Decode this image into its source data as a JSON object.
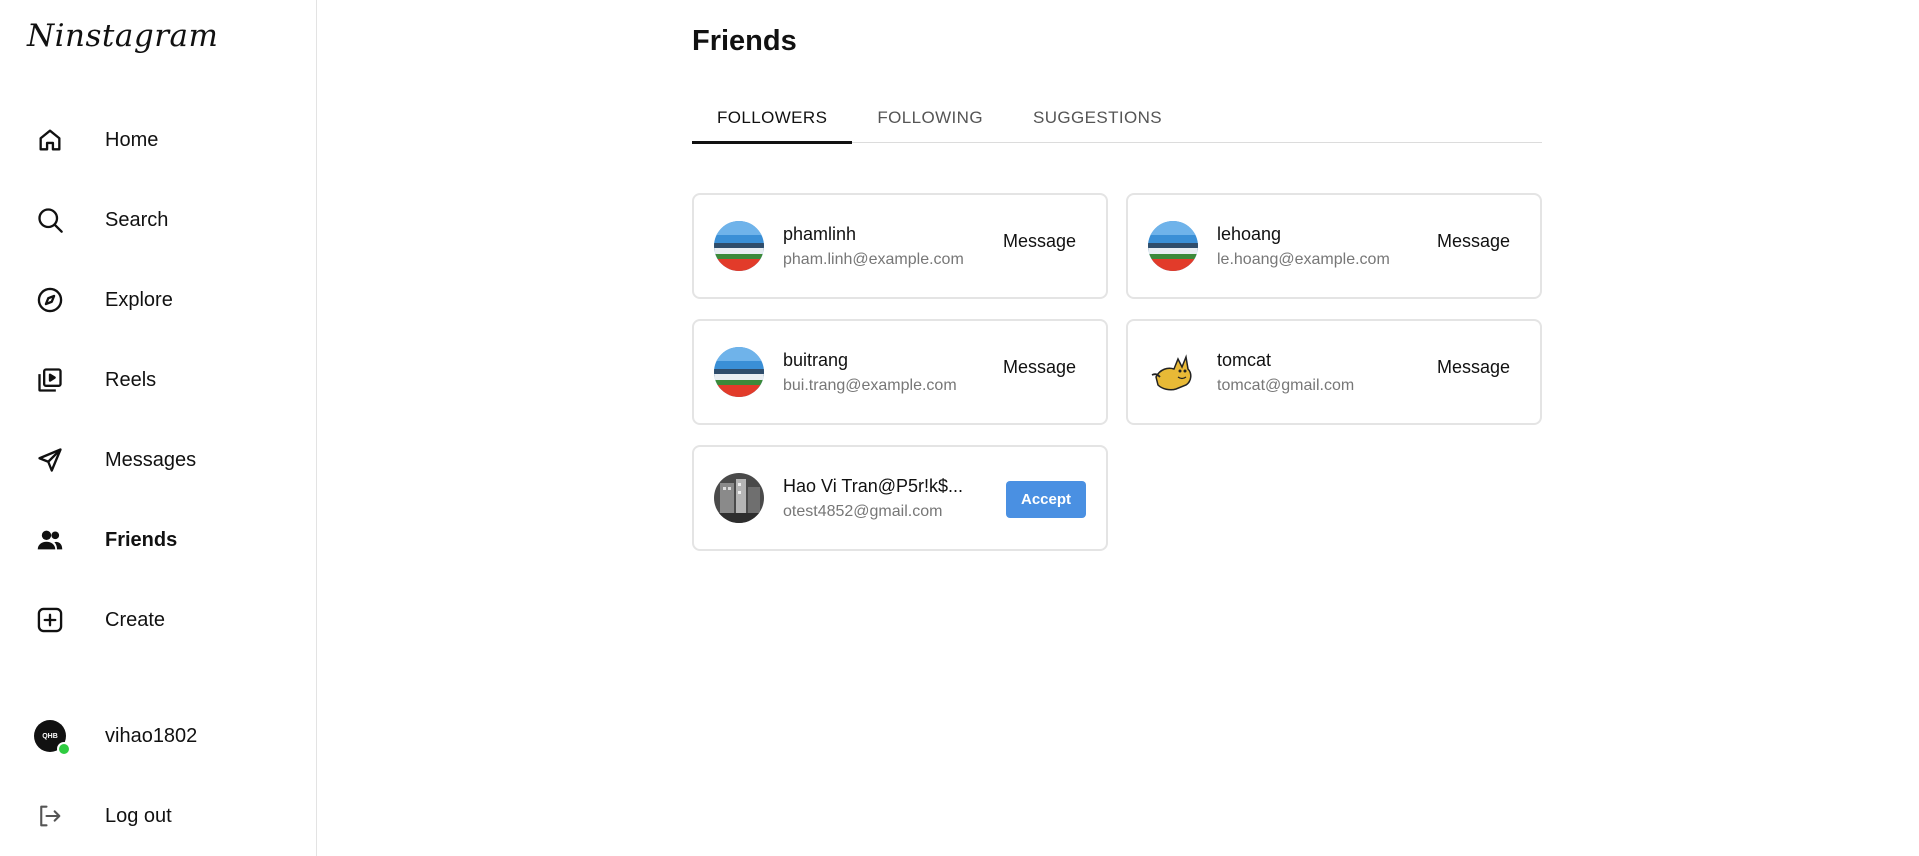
{
  "app": {
    "logo_text": "Ninstagram"
  },
  "sidebar": {
    "items": [
      {
        "label": "Home",
        "icon": "home-icon"
      },
      {
        "label": "Search",
        "icon": "search-icon"
      },
      {
        "label": "Explore",
        "icon": "compass-icon"
      },
      {
        "label": "Reels",
        "icon": "reels-icon"
      },
      {
        "label": "Messages",
        "icon": "send-icon"
      },
      {
        "label": "Friends",
        "icon": "people-icon",
        "active": true
      },
      {
        "label": "Create",
        "icon": "plus-square-icon"
      }
    ],
    "profile": {
      "username": "vihao1802",
      "avatar_text": "QHB",
      "online": true,
      "online_color": "#2ecc40"
    },
    "logout_label": "Log out"
  },
  "main": {
    "title": "Friends",
    "tabs": [
      {
        "label": "FOLLOWERS",
        "active": true
      },
      {
        "label": "FOLLOWING",
        "active": false
      },
      {
        "label": "SUGGESTIONS",
        "active": false
      }
    ],
    "cards": [
      {
        "username": "phamlinh",
        "email": "pham.linh@example.com",
        "action": "Message",
        "avatar": "stadium-avatar"
      },
      {
        "username": "lehoang",
        "email": "le.hoang@example.com",
        "action": "Message",
        "avatar": "stadium-avatar"
      },
      {
        "username": "buitrang",
        "email": "bui.trang@example.com",
        "action": "Message",
        "avatar": "stadium-avatar"
      },
      {
        "username": "tomcat",
        "email": "tomcat@gmail.com",
        "action": "Message",
        "avatar": "tomcat-avatar"
      },
      {
        "username": "Hao Vi Tran@P5r!k$...",
        "email": "otest4852@gmail.com",
        "action": "Accept",
        "avatar": "photo-avatar"
      }
    ]
  },
  "colors": {
    "accent": "#4a90e2",
    "online": "#2ecc40",
    "text": "#111111",
    "muted": "#777777"
  }
}
